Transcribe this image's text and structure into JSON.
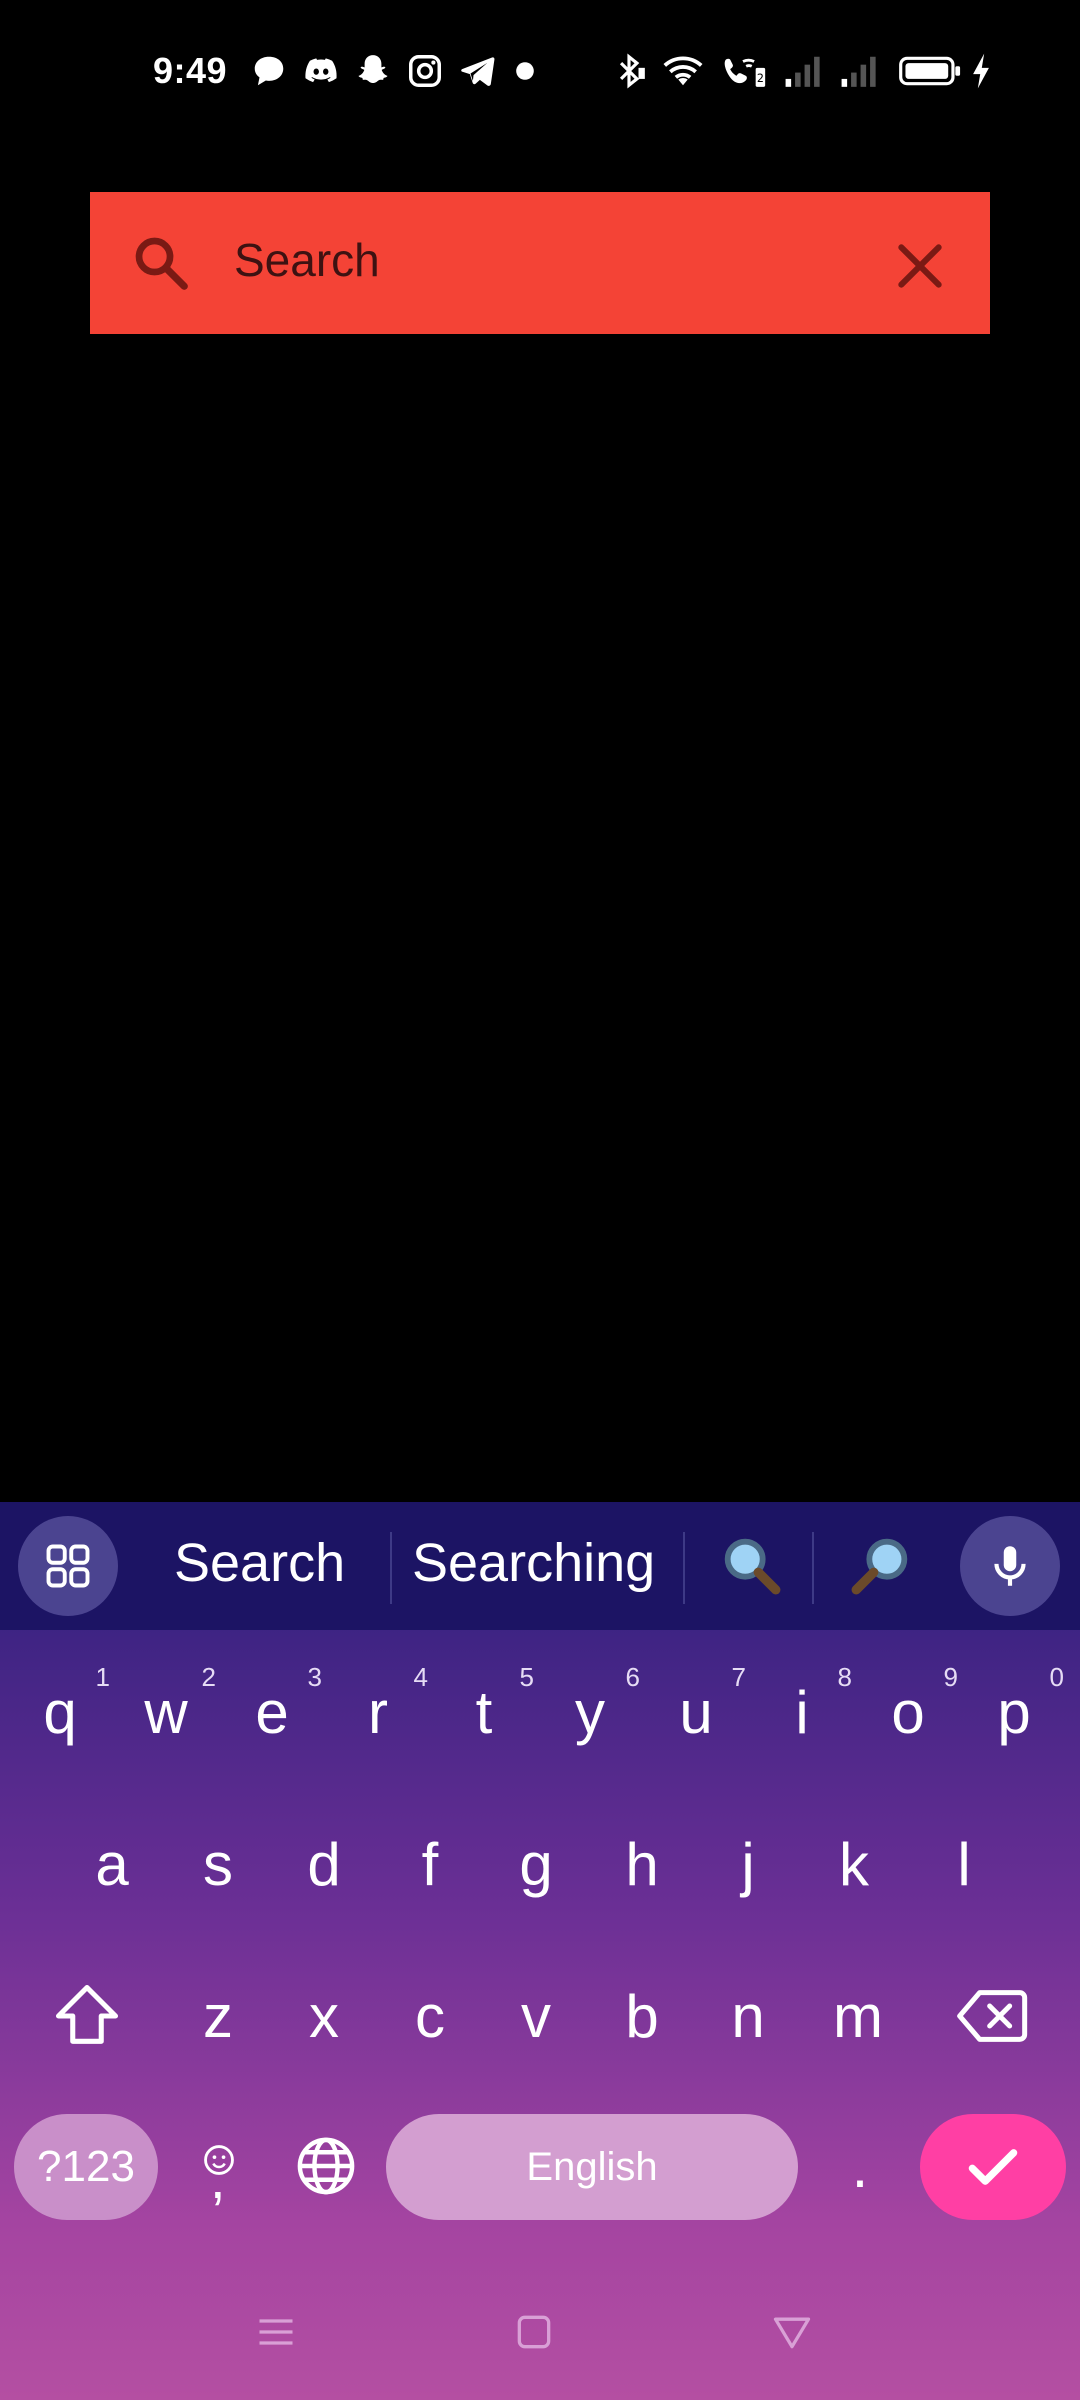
{
  "status_bar": {
    "time": "9:49",
    "left_icons": [
      "chat-bubble-icon",
      "discord-icon",
      "snapchat-icon",
      "instagram-icon",
      "telegram-icon",
      "dot-icon"
    ],
    "right_icons": [
      "bluetooth-icon",
      "wifi-icon",
      "wifi-calling-icon",
      "signal-sim1-icon",
      "signal-sim2-icon",
      "battery-icon",
      "charging-icon"
    ]
  },
  "search": {
    "placeholder": "Search",
    "value": "",
    "bar_color": "#f44336"
  },
  "keyboard": {
    "suggestions": [
      "Search",
      "Searching"
    ],
    "emoji_suggestions": [
      "magnifier-left-icon",
      "magnifier-right-icon"
    ],
    "row1": [
      {
        "key": "q",
        "hint": "1"
      },
      {
        "key": "w",
        "hint": "2"
      },
      {
        "key": "e",
        "hint": "3"
      },
      {
        "key": "r",
        "hint": "4"
      },
      {
        "key": "t",
        "hint": "5"
      },
      {
        "key": "y",
        "hint": "6"
      },
      {
        "key": "u",
        "hint": "7"
      },
      {
        "key": "i",
        "hint": "8"
      },
      {
        "key": "o",
        "hint": "9"
      },
      {
        "key": "p",
        "hint": "0"
      }
    ],
    "row2": [
      "a",
      "s",
      "d",
      "f",
      "g",
      "h",
      "j",
      "k",
      "l"
    ],
    "row3": [
      "z",
      "x",
      "c",
      "v",
      "b",
      "n",
      "m"
    ],
    "symbols_label": "?123",
    "comma_label": ",",
    "space_label": "English",
    "period_label": ".",
    "accent_color": "#ff3fa4"
  },
  "nav": {
    "icons": [
      "menu-icon",
      "home-icon",
      "back-icon"
    ]
  }
}
